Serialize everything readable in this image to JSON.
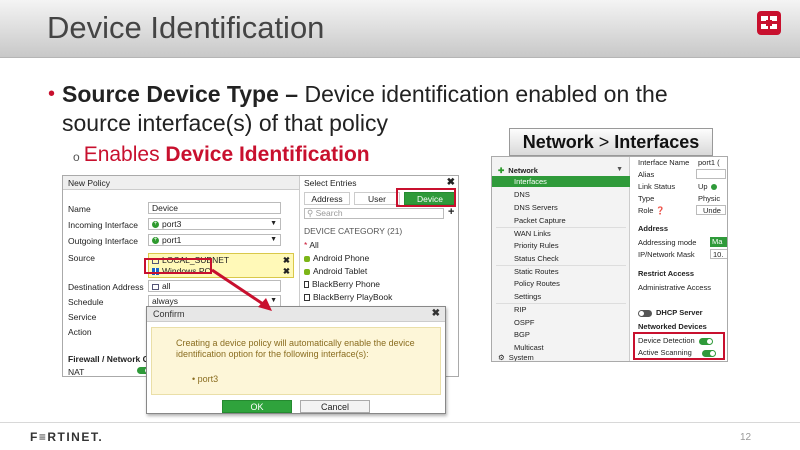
{
  "slide": {
    "title": "Device Identification",
    "bullet_bold": "Source Device Type –",
    "bullet_rest": "Device identification enabled on the source interface(s) of that policy",
    "sub_prefix": "Enables ",
    "sub_bold": "Device Identification",
    "breadcrumb_part1": "Network",
    "breadcrumb_sep": " > ",
    "breadcrumb_part2": "Interfaces",
    "page_number": "12",
    "logo_text": "F≡RTINET."
  },
  "new_policy": {
    "title": "New Policy",
    "fields": [
      {
        "label": "Name",
        "value": "Device"
      },
      {
        "label": "Incoming Interface",
        "value": "port3"
      },
      {
        "label": "Outgoing Interface",
        "value": "port1"
      },
      {
        "label": "Source",
        "value": "LOCAL_SUBNET"
      },
      {
        "label": "",
        "value": "Windows PC"
      },
      {
        "label": "Destination Address",
        "value": "all"
      },
      {
        "label": "Schedule",
        "value": "always"
      },
      {
        "label": "Service",
        "value": ""
      },
      {
        "label": "Action",
        "value": ""
      }
    ],
    "section_label": "Firewall / Network Op",
    "nat_label": "NAT"
  },
  "select_entries": {
    "title": "Select Entries",
    "tabs": [
      "Address",
      "User",
      "Device"
    ],
    "active_tab": "Device",
    "search_placeholder": "Search",
    "category": "DEVICE CATEGORY (21)",
    "items": [
      "All",
      "Android Phone",
      "Android Tablet",
      "BlackBerry Phone",
      "BlackBerry PlayBook"
    ]
  },
  "confirm": {
    "title": "Confirm",
    "message": "Creating a device policy will automatically enable the device identification option for the following interface(s):",
    "interface": "port3",
    "ok_label": "OK",
    "cancel_label": "Cancel"
  },
  "interfaces": {
    "nav_section": "Network",
    "nav_items": [
      "Interfaces",
      "DNS",
      "DNS Servers",
      "Packet Capture",
      "WAN Links",
      "Priority Rules",
      "Status Check",
      "Static Routes",
      "Policy Routes",
      "Settings",
      "RIP",
      "OSPF",
      "BGP",
      "Multicast"
    ],
    "nav_system": "System",
    "main": {
      "interface_name_label": "Interface Name",
      "interface_name_value": "port1 (",
      "alias_label": "Alias",
      "link_status_label": "Link Status",
      "link_status_value": "Up",
      "type_label": "Type",
      "type_value": "Physic",
      "role_label": "Role",
      "role_value": "Unde",
      "address_header": "Address",
      "addressing_mode_label": "Addressing mode",
      "addressing_mode_value": "Ma",
      "ip_label": "IP/Network Mask",
      "ip_value": "10.",
      "restrict_header": "Restrict Access",
      "admin_access_label": "Administrative Access",
      "dhcp_label": "DHCP Server",
      "networked_header": "Networked Devices",
      "device_detection_label": "Device Detection",
      "active_scanning_label": "Active Scanning"
    }
  },
  "colors": {
    "accent_red": "#c8102e",
    "fortinet_green": "#2f9a3a"
  }
}
